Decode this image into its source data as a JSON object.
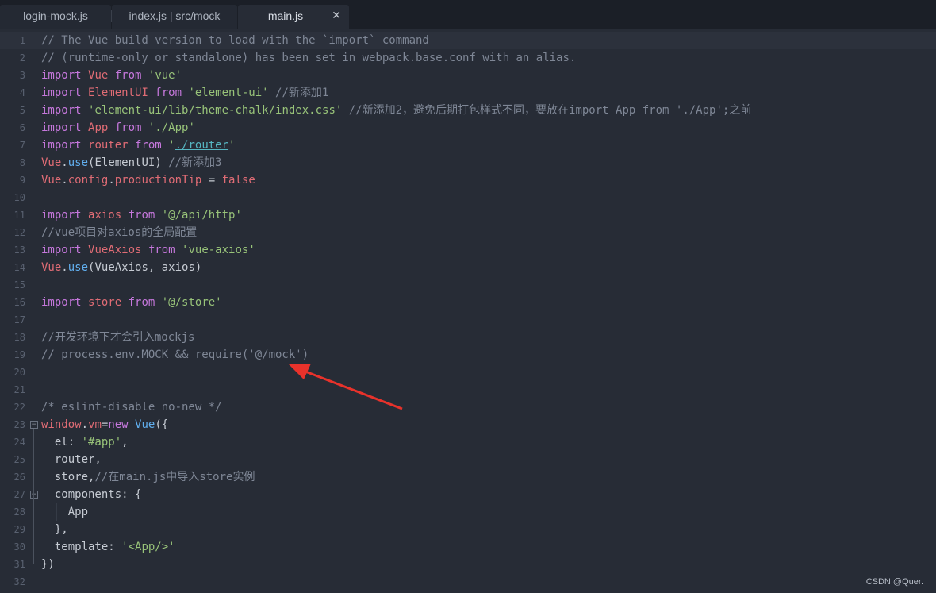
{
  "tabs": [
    {
      "label": "login-mock.js",
      "active": false
    },
    {
      "label": "index.js | src/mock",
      "active": false
    },
    {
      "label": "main.js",
      "active": true
    }
  ],
  "icons": {
    "tab_close": "close-icon",
    "fold": "fold-toggle-icon",
    "annotation": "red-arrow-icon"
  },
  "colors": {
    "annotation_arrow": "#e8322b",
    "background": "#272c36"
  },
  "current_line": 1,
  "folds": [
    23,
    27
  ],
  "lines": [
    {
      "n": "1",
      "tokens": [
        {
          "t": "// The Vue build version to load with the `import` command",
          "c": "comment"
        }
      ]
    },
    {
      "n": "2",
      "tokens": [
        {
          "t": "// (runtime-only or standalone) has been set in webpack.base.conf with an alias.",
          "c": "comment"
        }
      ]
    },
    {
      "n": "3",
      "tokens": [
        {
          "t": "import ",
          "c": "kw"
        },
        {
          "t": "Vue",
          "c": "id"
        },
        {
          "t": " from ",
          "c": "kw"
        },
        {
          "t": "'vue'",
          "c": "str"
        }
      ]
    },
    {
      "n": "4",
      "tokens": [
        {
          "t": "import ",
          "c": "kw"
        },
        {
          "t": "ElementUI",
          "c": "id"
        },
        {
          "t": " from ",
          "c": "kw"
        },
        {
          "t": "'element-ui'",
          "c": "str"
        },
        {
          "t": " //新添加1",
          "c": "comment"
        }
      ]
    },
    {
      "n": "5",
      "tokens": [
        {
          "t": "import ",
          "c": "kw"
        },
        {
          "t": "'element-ui/lib/theme-chalk/index.css'",
          "c": "str"
        },
        {
          "t": " //新添加2，避免后期打包样式不同，要放在import App from './App';之前",
          "c": "comment"
        }
      ]
    },
    {
      "n": "6",
      "tokens": [
        {
          "t": "import ",
          "c": "kw"
        },
        {
          "t": "App",
          "c": "id"
        },
        {
          "t": " from ",
          "c": "kw"
        },
        {
          "t": "'./App'",
          "c": "str"
        }
      ]
    },
    {
      "n": "7",
      "tokens": [
        {
          "t": "import ",
          "c": "kw"
        },
        {
          "t": "router",
          "c": "id"
        },
        {
          "t": " from ",
          "c": "kw"
        },
        {
          "t": "'",
          "c": "str"
        },
        {
          "t": "./router",
          "c": "link"
        },
        {
          "t": "'",
          "c": "str"
        }
      ]
    },
    {
      "n": "8",
      "tokens": [
        {
          "t": "Vue",
          "c": "id"
        },
        {
          "t": ".",
          "c": "plain"
        },
        {
          "t": "use",
          "c": "fn"
        },
        {
          "t": "(ElementUI) ",
          "c": "plain"
        },
        {
          "t": "//新添加3",
          "c": "comment"
        }
      ]
    },
    {
      "n": "9",
      "tokens": [
        {
          "t": "Vue",
          "c": "id"
        },
        {
          "t": ".",
          "c": "plain"
        },
        {
          "t": "config",
          "c": "id"
        },
        {
          "t": ".",
          "c": "plain"
        },
        {
          "t": "productionTip",
          "c": "id"
        },
        {
          "t": " = ",
          "c": "plain"
        },
        {
          "t": "false",
          "c": "id"
        }
      ]
    },
    {
      "n": "10",
      "tokens": []
    },
    {
      "n": "11",
      "tokens": [
        {
          "t": "import ",
          "c": "kw"
        },
        {
          "t": "axios",
          "c": "id"
        },
        {
          "t": " from ",
          "c": "kw"
        },
        {
          "t": "'@/api/http'",
          "c": "str"
        }
      ]
    },
    {
      "n": "12",
      "tokens": [
        {
          "t": "//vue项目对axios的全局配置",
          "c": "comment"
        }
      ]
    },
    {
      "n": "13",
      "tokens": [
        {
          "t": "import ",
          "c": "kw"
        },
        {
          "t": "VueAxios",
          "c": "id"
        },
        {
          "t": " from ",
          "c": "kw"
        },
        {
          "t": "'vue-axios'",
          "c": "str"
        }
      ]
    },
    {
      "n": "14",
      "tokens": [
        {
          "t": "Vue",
          "c": "id"
        },
        {
          "t": ".",
          "c": "plain"
        },
        {
          "t": "use",
          "c": "fn"
        },
        {
          "t": "(VueAxios, axios)",
          "c": "plain"
        }
      ]
    },
    {
      "n": "15",
      "tokens": []
    },
    {
      "n": "16",
      "tokens": [
        {
          "t": "import ",
          "c": "kw"
        },
        {
          "t": "store",
          "c": "id"
        },
        {
          "t": " from ",
          "c": "kw"
        },
        {
          "t": "'@/store'",
          "c": "str"
        }
      ]
    },
    {
      "n": "17",
      "tokens": []
    },
    {
      "n": "18",
      "tokens": [
        {
          "t": "//开发环境下才会引入mockjs",
          "c": "comment"
        }
      ]
    },
    {
      "n": "19",
      "tokens": [
        {
          "t": "// process.env.MOCK && require('@/mock')",
          "c": "comment"
        }
      ]
    },
    {
      "n": "20",
      "tokens": []
    },
    {
      "n": "21",
      "tokens": []
    },
    {
      "n": "22",
      "tokens": [
        {
          "t": "/* eslint-disable no-new */",
          "c": "comment"
        }
      ]
    },
    {
      "n": "23",
      "tokens": [
        {
          "t": "window",
          "c": "id"
        },
        {
          "t": ".",
          "c": "plain"
        },
        {
          "t": "vm",
          "c": "id"
        },
        {
          "t": "=",
          "c": "plain"
        },
        {
          "t": "new ",
          "c": "kw"
        },
        {
          "t": "Vue",
          "c": "fn"
        },
        {
          "t": "({",
          "c": "plain"
        }
      ]
    },
    {
      "n": "24",
      "tokens": [
        {
          "t": "  el: ",
          "c": "plain"
        },
        {
          "t": "'#app'",
          "c": "str"
        },
        {
          "t": ",",
          "c": "plain"
        }
      ]
    },
    {
      "n": "25",
      "tokens": [
        {
          "t": "  router,",
          "c": "plain"
        }
      ]
    },
    {
      "n": "26",
      "tokens": [
        {
          "t": "  store,",
          "c": "plain"
        },
        {
          "t": "//在main.js中导入store实例",
          "c": "comment"
        }
      ]
    },
    {
      "n": "27",
      "tokens": [
        {
          "t": "  components: {",
          "c": "plain"
        }
      ]
    },
    {
      "n": "28",
      "tokens": [
        {
          "t": "    App",
          "c": "plain"
        }
      ]
    },
    {
      "n": "29",
      "tokens": [
        {
          "t": "  },",
          "c": "plain"
        }
      ]
    },
    {
      "n": "30",
      "tokens": [
        {
          "t": "  template: ",
          "c": "plain"
        },
        {
          "t": "'<App/>'",
          "c": "str"
        }
      ]
    },
    {
      "n": "31",
      "tokens": [
        {
          "t": "})",
          "c": "plain"
        }
      ]
    },
    {
      "n": "32",
      "tokens": []
    }
  ],
  "watermark": "CSDN @Quer."
}
